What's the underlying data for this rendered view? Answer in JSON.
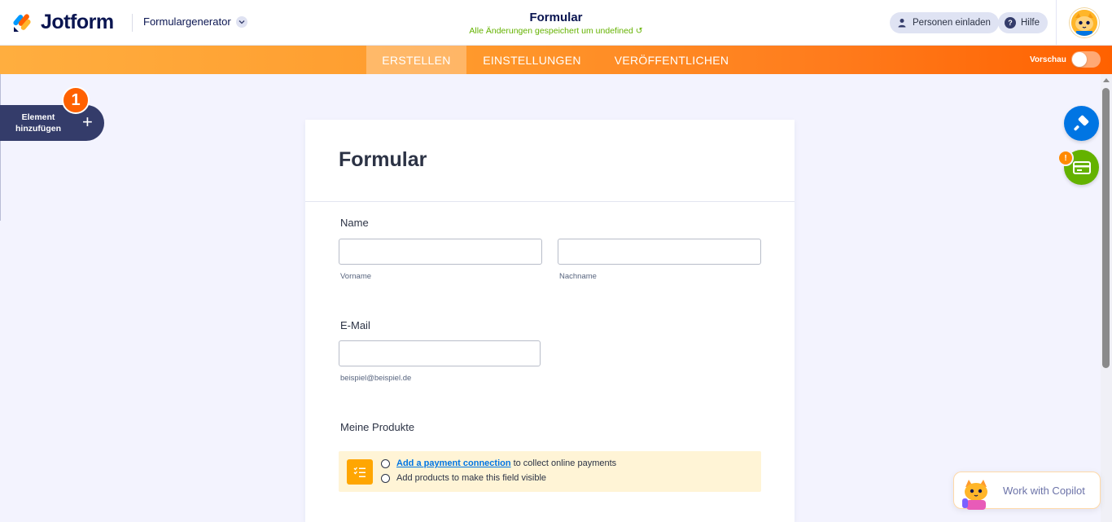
{
  "header": {
    "brand": "Jotform",
    "builder_switch": "Formulargenerator",
    "form_title": "Formular",
    "save_status": "Alle Änderungen gespeichert um undefined",
    "invite_label": "Personen einladen",
    "help_label": "Hilfe"
  },
  "nav": {
    "tabs": [
      {
        "label": "ERSTELLEN",
        "active": true
      },
      {
        "label": "EINSTELLUNGEN",
        "active": false
      },
      {
        "label": "VERÖFFENTLICHEN",
        "active": false
      }
    ],
    "preview_label": "Vorschau",
    "preview_on": false
  },
  "sidebar": {
    "add_element_label": "Element hinzufügen",
    "step_badge": "1"
  },
  "form": {
    "heading": "Formular",
    "fields": {
      "name": {
        "label": "Name",
        "first_sublabel": "Vorname",
        "last_sublabel": "Nachname",
        "first_value": "",
        "last_value": ""
      },
      "email": {
        "label": "E-Mail",
        "sublabel": "beispiel@beispiel.de",
        "value": ""
      },
      "products": {
        "label": "Meine Produkte",
        "payment_link": "Add a payment connection",
        "payment_suffix": "to collect online payments",
        "add_products_text": "Add products to make this field visible"
      }
    }
  },
  "right_tools": {
    "warning_badge": "!",
    "copilot_label": "Work with Copilot"
  },
  "colors": {
    "brand_dark": "#0a1551",
    "orange": "#ff6100",
    "blue": "#0075e3",
    "green": "#64b200",
    "sidebar_dark": "#343c6a"
  }
}
